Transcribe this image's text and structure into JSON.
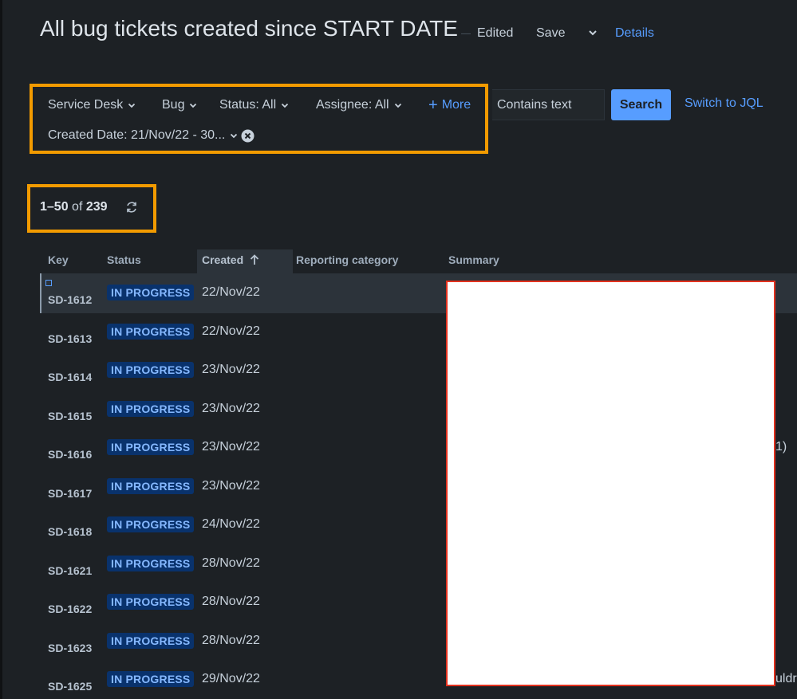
{
  "header": {
    "title": "All bug tickets created since START DATE",
    "edited": "Edited",
    "save": "Save",
    "details": "Details"
  },
  "filters": {
    "project": "Service Desk",
    "type": "Bug",
    "status": "Status: All",
    "assignee": "Assignee: All",
    "more": "More",
    "created_date": "Created Date: 21/Nov/22 - 30...",
    "search_placeholder": "Contains text",
    "search_button": "Search",
    "switch_jql": "Switch to JQL"
  },
  "results": {
    "range": "1–50",
    "of": "of",
    "total": "239"
  },
  "table": {
    "columns": {
      "key": "Key",
      "status": "Status",
      "created": "Created",
      "reporting_category": "Reporting category",
      "summary": "Summary"
    },
    "rows": [
      {
        "key": "SD-1612",
        "status": "IN PROGRESS",
        "created": "22/Nov/22",
        "trail": ""
      },
      {
        "key": "SD-1613",
        "status": "IN PROGRESS",
        "created": "22/Nov/22",
        "trail": ""
      },
      {
        "key": "SD-1614",
        "status": "IN PROGRESS",
        "created": "23/Nov/22",
        "trail": ""
      },
      {
        "key": "SD-1615",
        "status": "IN PROGRESS",
        "created": "23/Nov/22",
        "trail": ""
      },
      {
        "key": "SD-1616",
        "status": "IN PROGRESS",
        "created": "23/Nov/22",
        "trail": "1)"
      },
      {
        "key": "SD-1617",
        "status": "IN PROGRESS",
        "created": "23/Nov/22",
        "trail": ""
      },
      {
        "key": "SD-1618",
        "status": "IN PROGRESS",
        "created": "24/Nov/22",
        "trail": ""
      },
      {
        "key": "SD-1621",
        "status": "IN PROGRESS",
        "created": "28/Nov/22",
        "trail": ""
      },
      {
        "key": "SD-1622",
        "status": "IN PROGRESS",
        "created": "28/Nov/22",
        "trail": ""
      },
      {
        "key": "SD-1623",
        "status": "IN PROGRESS",
        "created": "28/Nov/22",
        "trail": ""
      },
      {
        "key": "SD-1625",
        "status": "IN PROGRESS",
        "created": "29/Nov/22",
        "trail": "uldr"
      }
    ]
  },
  "colors": {
    "background": "#1d2125",
    "accent": "#579dff",
    "highlight_border": "#f29b00",
    "redaction_border": "#e3311e",
    "status_lozenge_bg": "#09326c",
    "status_lozenge_text": "#85b8ff"
  },
  "icons": [
    "chevron-down-icon",
    "plus-icon",
    "clear-icon",
    "refresh-icon",
    "sort-arrow-up-icon"
  ]
}
